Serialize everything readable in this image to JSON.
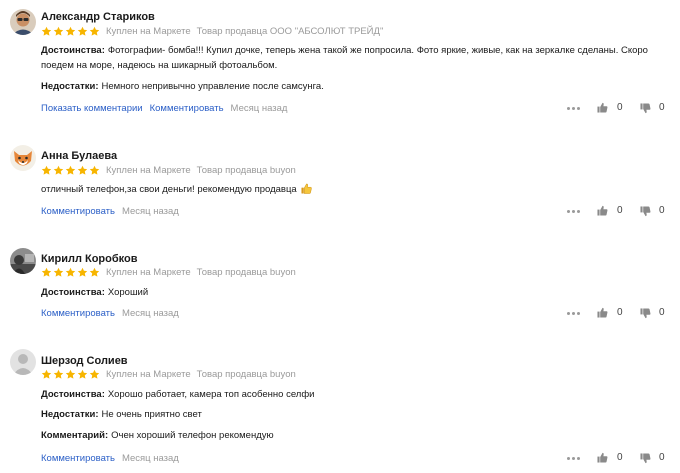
{
  "colors": {
    "star": "#f7b500",
    "link": "#2b5fc7",
    "muted": "#9a9a9a"
  },
  "reviews": [
    {
      "author": "Александр Стариков",
      "bought": "Куплен на Маркете",
      "seller": "Товар продавца ООО \"АБСОЛЮТ ТРЕЙД\"",
      "rating": 5,
      "pros_label": "Достоинства:",
      "pros": "Фотографии- бомба!!! Купил дочке, теперь жена такой же попросила. Фото яркие, живые, как на зеркалке сделаны. Скоро поедем на море, надеюсь на шикарный фотоальбом.",
      "cons_label": "Недостатки:",
      "cons": "Немного непривычно управление после самсунга.",
      "show_comments": "Показать комментарии",
      "comment": "Комментировать",
      "when": "Месяц назад",
      "likes": "0",
      "dislikes": "0"
    },
    {
      "author": "Анна Булаева",
      "bought": "Куплен на Маркете",
      "seller": "Товар продавца buyon",
      "rating": 5,
      "text": "отличный телефон,за свои деньги! рекомендую продавца",
      "comment": "Комментировать",
      "when": "Месяц назад",
      "likes": "0",
      "dislikes": "0"
    },
    {
      "author": "Кирилл Коробков",
      "bought": "Куплен на Маркете",
      "seller": "Товар продавца buyon",
      "rating": 5,
      "pros_label": "Достоинства:",
      "pros": "Хороший",
      "comment": "Комментировать",
      "when": "Месяц назад",
      "likes": "0",
      "dislikes": "0"
    },
    {
      "author": "Шерзод Солиев",
      "bought": "Куплен на Маркете",
      "seller": "Товар продавца buyon",
      "rating": 5,
      "pros_label": "Достоинства:",
      "pros": "Хорошо работает, камера топ асобенно селфи",
      "cons_label": "Недостатки:",
      "cons": "Не очень приятно свет",
      "comment_label": "Комментарий:",
      "comment_text": "Очен хороший телефон рекомендую",
      "comment": "Комментировать",
      "when": "Месяц назад",
      "likes": "0",
      "dislikes": "0"
    }
  ],
  "icons": {
    "like": "thumb-up-icon",
    "dislike": "thumb-down-icon",
    "more": "more-dots-icon",
    "star": "star-icon"
  }
}
